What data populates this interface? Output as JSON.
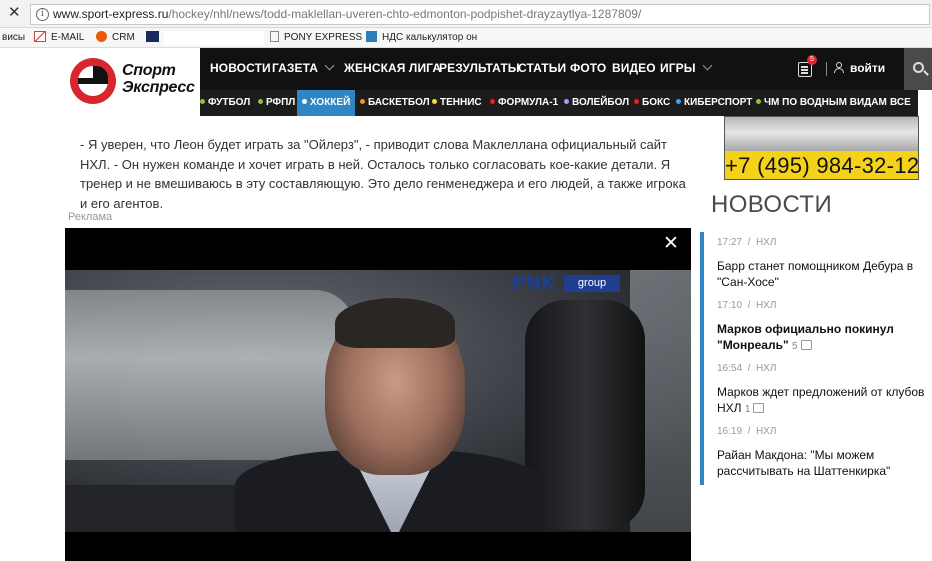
{
  "browser": {
    "url_host": "www.sport-express.ru",
    "url_path": "/hockey/nhl/news/todd-maklellan-uveren-chto-edmonton-podpishet-drayzaytlya-1287809/",
    "bookmarks": [
      {
        "label": "висы",
        "icon": "none"
      },
      {
        "label": "E-MAIL",
        "icon": "gmail-icon"
      },
      {
        "label": "CRM",
        "icon": "crm-icon"
      },
      {
        "label": "",
        "icon": "bookmark-icon"
      },
      {
        "label": "PONY EXPRESS",
        "icon": "page-icon"
      },
      {
        "label": "НДС калькулятор он",
        "icon": "bookmark-icon"
      }
    ]
  },
  "site": {
    "logo_line1": "Спорт",
    "logo_line2": "Экспресс",
    "nav": [
      "НОВОСТИ",
      "ГАЗЕТА",
      "ЖЕНСКАЯ ЛИГА",
      "РЕЗУЛЬТАТЫ",
      "СТАТЬИ",
      "ФОТО",
      "ВИДЕО",
      "ИГРЫ"
    ],
    "notif_count": "5",
    "login": "войти",
    "sports": [
      {
        "label": "ФУТБОЛ",
        "dot": "#8dc63f"
      },
      {
        "label": "РФПЛ",
        "dot": "#8dc63f"
      },
      {
        "label": "ХОККЕЙ",
        "dot": "#ffffff"
      },
      {
        "label": "БАСКЕТБОЛ",
        "dot": "#f7941d"
      },
      {
        "label": "ТЕННИС",
        "dot": "#f4e12a"
      },
      {
        "label": "ФОРМУЛА-1",
        "dot": "#ed1c24"
      },
      {
        "label": "ВОЛЕЙБОЛ",
        "dot": "#9e9eff"
      },
      {
        "label": "БОКС",
        "dot": "#ed1c24"
      },
      {
        "label": "КИБЕРСПОРТ",
        "dot": "#3aa0ff"
      },
      {
        "label": "ЧМ ПО ВОДНЫМ ВИДАМ",
        "dot": "#8dc63f"
      },
      {
        "label": "ВСЕ",
        "dot": "none"
      }
    ],
    "active_color": "#2f86c5"
  },
  "article": {
    "text": "- Я уверен, что Леон будет играть за \"Ойлерз\", - приводит слова Маклеллана официальный сайт НХЛ. - Он нужен команде и хочет играть в ней. Осталось только согласовать кое-какие детали. Я тренер и не вмешиваюсь в эту составляющую. Это дело генменеджера и его людей, а также игрока и его агентов.",
    "ad_label": "Реклама",
    "video_brand": "PNK",
    "video_brand_suffix": "group"
  },
  "sidebar": {
    "phone": "+7 (495) 984-32-12",
    "news_title": "НОВОСТИ",
    "news": [
      {
        "time": "17:27",
        "tag": "НХЛ",
        "headline": "Барр станет помощником Дебура в \"Сан-Хосе\"",
        "bold": false,
        "comments": ""
      },
      {
        "time": "17:10",
        "tag": "НХЛ",
        "headline": "Марков официально покинул \"Монреаль\"",
        "bold": true,
        "comments": "5"
      },
      {
        "time": "16:54",
        "tag": "НХЛ",
        "headline": "Марков ждет предложений от клубов НХЛ",
        "bold": false,
        "comments": "1"
      },
      {
        "time": "16:19",
        "tag": "НХЛ",
        "headline": "Райан Макдона: \"Мы можем рассчитывать на Шаттенкирка\"",
        "bold": false,
        "comments": ""
      }
    ]
  }
}
